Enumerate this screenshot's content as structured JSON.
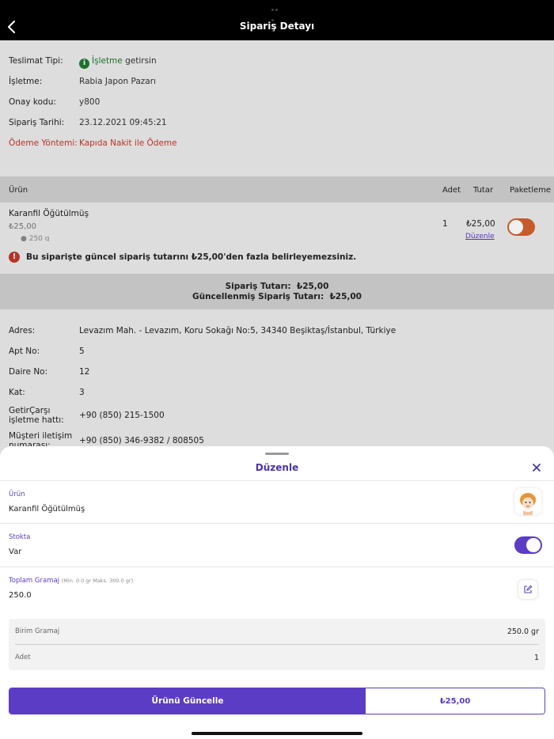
{
  "header": {
    "title": "Sipariş Detayı"
  },
  "order": {
    "delivery_label": "Teslimat Tipi:",
    "delivery_value": "İşletme",
    "delivery_suffix": "getirsin",
    "business_label": "İşletme:",
    "business_value": "Rabia Japon Pazarı",
    "code_label": "Onay kodu:",
    "code_value": "y800",
    "date_label": "Sipariş Tarihi:",
    "date_value": "23.12.2021 09:45:21",
    "payment_label": "Ödeme Yöntemi:",
    "payment_value": "Kapıda Nakit ile Ödeme"
  },
  "table": {
    "headers": {
      "product": "Ürün",
      "qty": "Adet",
      "total": "Tutar",
      "packaging": "Paketleme"
    },
    "item": {
      "name": "Karanfil Öğütülmüş",
      "price": "₺25,00",
      "gram": "250 g",
      "qty": "1",
      "total": "₺25,00",
      "edit": "Düzenle"
    }
  },
  "warning": "Bu siparişte güncel sipariş tutarını ₺25,00'den fazla belirleyemezsiniz.",
  "totals": {
    "order_label": "Sipariş Tutarı:",
    "order_value": "₺25,00",
    "updated_label": "Güncellenmiş Sipariş Tutarı:",
    "updated_value": "₺25,00"
  },
  "address": {
    "addr_label": "Adres:",
    "addr_value": "Levazım Mah. - Levazım, Koru Sokağı No:5, 34340 Beşiktaş/İstanbul, Türkiye",
    "apt_label": "Apt No:",
    "apt_value": "5",
    "door_label": "Daire No:",
    "door_value": "12",
    "floor_label": "Kat:",
    "floor_value": "3",
    "hotline_label": "GetirÇarşı işletme hattı:",
    "hotline_value": "+90 (850) 215-1500",
    "customer_label": "Müşteri iletişim numarası:",
    "customer_value": "+90 (850) 346-9382 / 808505"
  },
  "sheet": {
    "title": "Düzenle",
    "product_label": "Ürün",
    "product_value": "Karanfil Öğütülmüş",
    "stock_label": "Stokta",
    "stock_value": "Var",
    "gram_label": "Toplam Gramaj",
    "gram_hint": "(Min. 0.0 gr Maks. 300.0 gr)",
    "gram_value": "250.0",
    "unit_gram_label": "Birim Gramaj",
    "unit_gram_value": "250.0 gr",
    "qty_label": "Adet",
    "qty_value": "1",
    "update_button": "Ürünü Güncelle",
    "price_button": "₺25,00"
  },
  "colors": {
    "accent": "#5b3cc4",
    "toggle_off": "#d2602e",
    "error": "#c0392b",
    "green": "#1e7a2f"
  }
}
